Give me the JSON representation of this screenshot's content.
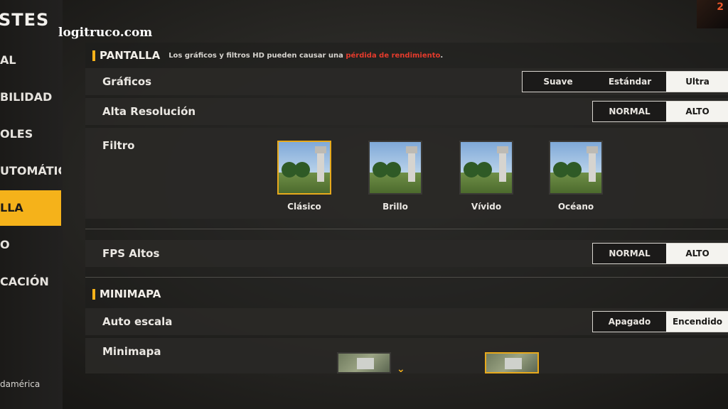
{
  "sidebar": {
    "title": "STES",
    "items": [
      {
        "label": "AL",
        "active": false
      },
      {
        "label": "BILIDAD",
        "active": false
      },
      {
        "label": "OLES",
        "active": false
      },
      {
        "label": "UTOMÁTICA",
        "active": false
      },
      {
        "label": "LLA",
        "active": true
      },
      {
        "label": "O",
        "active": false
      },
      {
        "label": "CACIÓN",
        "active": false
      }
    ],
    "region": "damérica"
  },
  "watermark": "logitruco.com",
  "corner_badge": "2",
  "pantalla": {
    "title": "PANTALLA",
    "note_prefix": "Los gráficos y filtros HD pueden causar una ",
    "note_warning": "pérdida de rendimiento",
    "note_suffix": "."
  },
  "graficos": {
    "label": "Gráficos",
    "options": [
      "Suave",
      "Estándar",
      "Ultra"
    ],
    "selected": "Ultra"
  },
  "alta_resolucion": {
    "label": "Alta Resolución",
    "options": [
      "NORMAL",
      "ALTO"
    ],
    "selected": "ALTO"
  },
  "filtro": {
    "label": "Filtro",
    "options": [
      {
        "label": "Clásico",
        "selected": true
      },
      {
        "label": "Brillo",
        "selected": false
      },
      {
        "label": "Vívido",
        "selected": false
      },
      {
        "label": "Océano",
        "selected": false
      }
    ]
  },
  "fps_altos": {
    "label": "FPS Altos",
    "options": [
      "NORMAL",
      "ALTO"
    ],
    "selected": "ALTO"
  },
  "minimapa_section": {
    "title": "MINIMAPA"
  },
  "auto_escala": {
    "label": "Auto escala",
    "options": [
      "Apagado",
      "Encendido"
    ],
    "selected": "Encendido"
  },
  "minimapa": {
    "label": "Minimapa"
  },
  "colors": {
    "accent": "#f5b21a",
    "warning": "#e53b2c",
    "selected_option_bg": "#f4f3ef"
  }
}
